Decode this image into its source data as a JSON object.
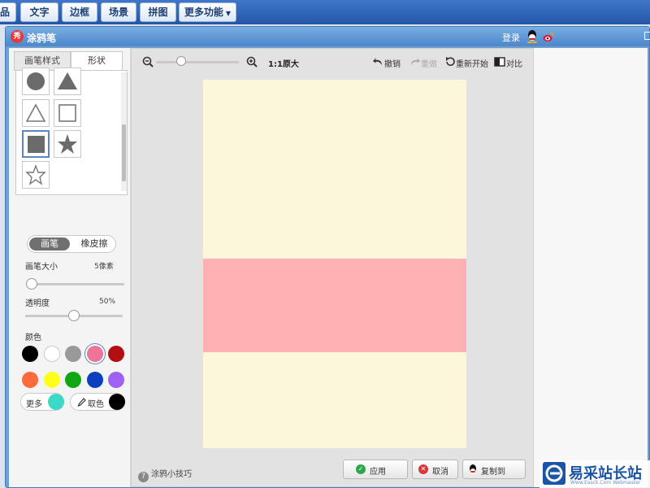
{
  "menubar": {
    "items": [
      {
        "label": "品"
      },
      {
        "label": "文字"
      },
      {
        "label": "边框"
      },
      {
        "label": "场景"
      },
      {
        "label": "拼图"
      },
      {
        "label": "更多功能"
      }
    ],
    "more_caret": "▼"
  },
  "dialog": {
    "app_icon_text": "秀",
    "title": "涂鸦笔",
    "login": "登录",
    "icons": [
      "qq-icon",
      "weibo-icon"
    ]
  },
  "left": {
    "tabs": [
      {
        "label": "画笔样式",
        "active": false
      },
      {
        "label": "形状",
        "active": true
      }
    ],
    "shapes": [
      "filled-circle",
      "filled-triangle",
      "outline-triangle",
      "outline-square",
      "filled-square",
      "filled-star",
      "outline-star"
    ],
    "selected_shape": "filled-square",
    "mode": {
      "brush": "画笔",
      "eraser": "橡皮擦",
      "active": "brush"
    },
    "brush_size": {
      "label": "画笔大小",
      "value": "5像素",
      "level": 0.05
    },
    "opacity": {
      "label": "透明度",
      "value": "50%",
      "level": 0.5
    },
    "color": {
      "label": "颜色",
      "swatches": [
        "#000000",
        "#ffffff",
        "#999999",
        "#f0739a",
        "#b30e14",
        "#ff6a3d",
        "#ffff1a",
        "#12a712",
        "#0a3fc0",
        "#9e61f2"
      ],
      "selected": "#f0739a",
      "more_label": "更多",
      "more_color": "#3dd9c7",
      "picker_label": "取色",
      "picker_color": "#000000"
    }
  },
  "canvas": {
    "zoom_label": "1:1原大",
    "undo": "撤销",
    "redo": "重做",
    "restart": "重新开始",
    "compare": "对比",
    "zoom_level": 0.3,
    "paper_color": "#fcf6da",
    "band_color": "#ffb1b4"
  },
  "footer": {
    "tips": "涂鸦小技巧",
    "apply": "应用",
    "cancel": "取消",
    "copy": "复制到"
  },
  "watermark": {
    "text": "易采站长站",
    "sub": "Www.Easck.Com  Webmaster"
  }
}
